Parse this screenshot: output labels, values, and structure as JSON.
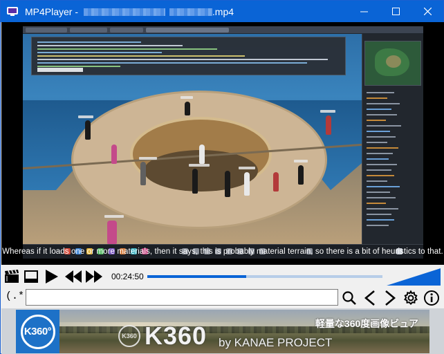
{
  "window": {
    "app_name": "MP4Player",
    "title_prefix": "MP4Player - ",
    "title_suffix": ".mp4",
    "accent": "#0a64d6"
  },
  "titlebar_controls": {
    "minimize_icon": "minimize-icon",
    "maximize_icon": "maximize-icon",
    "close_icon": "close-icon"
  },
  "video": {
    "subtitle": "Whereas if it loads one or more materials, then it says, this is probably material terrain, so there is a bit of heuristics to that."
  },
  "controls": {
    "time": "00:24:50",
    "progress_fraction": 0.42,
    "volume_fraction": 1.0,
    "regex_label": "(.*)",
    "search_value": "",
    "icons": [
      "clapperboard-icon",
      "window-icon",
      "play-icon",
      "rewind-icon",
      "fast-forward-icon",
      "search-icon",
      "previous-icon",
      "next-icon",
      "settings-icon",
      "info-icon"
    ]
  },
  "banner": {
    "logo_text": "K360°",
    "mark_text": "K360",
    "title": "K360",
    "byline": "by KANAE PROJECT",
    "tagline": "軽量な360度画像ビュア"
  }
}
